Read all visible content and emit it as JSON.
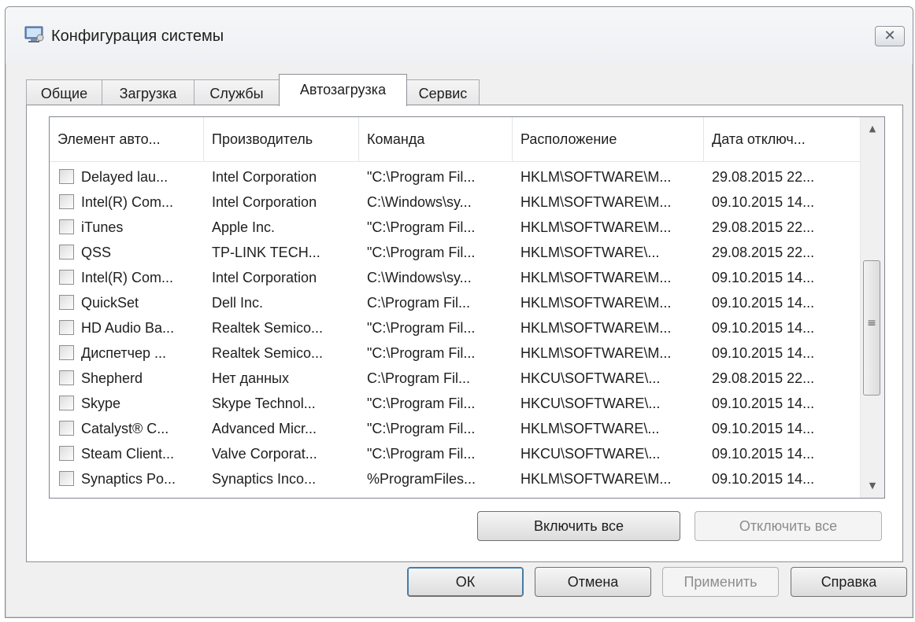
{
  "window": {
    "title": "Конфигурация системы",
    "close_glyph": "✕"
  },
  "tabs": [
    {
      "label": "Общие",
      "active": false
    },
    {
      "label": "Загрузка",
      "active": false
    },
    {
      "label": "Службы",
      "active": false
    },
    {
      "label": "Автозагрузка",
      "active": true
    },
    {
      "label": "Сервис",
      "active": false
    }
  ],
  "list": {
    "columns": [
      "Элемент авто...",
      "Производитель",
      "Команда",
      "Расположение",
      "Дата отключ..."
    ],
    "rows": [
      [
        "Delayed lau...",
        "Intel Corporation",
        "\"C:\\Program Fil...",
        "HKLM\\SOFTWARE\\M...",
        "29.08.2015 22..."
      ],
      [
        "Intel(R) Com...",
        "Intel Corporation",
        "C:\\Windows\\sy...",
        "HKLM\\SOFTWARE\\M...",
        "09.10.2015 14..."
      ],
      [
        "iTunes",
        "Apple Inc.",
        "\"C:\\Program Fil...",
        "HKLM\\SOFTWARE\\M...",
        "29.08.2015 22..."
      ],
      [
        "QSS",
        "TP-LINK TECH...",
        "\"C:\\Program Fil...",
        "HKLM\\SOFTWARE\\...",
        "29.08.2015 22..."
      ],
      [
        "Intel(R) Com...",
        "Intel Corporation",
        "C:\\Windows\\sy...",
        "HKLM\\SOFTWARE\\M...",
        "09.10.2015 14..."
      ],
      [
        "QuickSet",
        "Dell Inc.",
        "C:\\Program Fil...",
        "HKLM\\SOFTWARE\\M...",
        "09.10.2015 14..."
      ],
      [
        "HD Audio Ba...",
        "Realtek Semico...",
        "\"C:\\Program Fil...",
        "HKLM\\SOFTWARE\\M...",
        "09.10.2015 14..."
      ],
      [
        "Диспетчер ...",
        "Realtek Semico...",
        "\"C:\\Program Fil...",
        "HKLM\\SOFTWARE\\M...",
        "09.10.2015 14..."
      ],
      [
        "Shepherd",
        "Нет данных",
        "C:\\Program Fil...",
        "HKCU\\SOFTWARE\\...",
        "29.08.2015 22..."
      ],
      [
        "Skype",
        "Skype Technol...",
        "\"C:\\Program Fil...",
        "HKCU\\SOFTWARE\\...",
        "09.10.2015 14..."
      ],
      [
        "Catalyst® C...",
        "Advanced Micr...",
        "\"C:\\Program Fil...",
        "HKLM\\SOFTWARE\\...",
        "09.10.2015 14..."
      ],
      [
        "Steam Client...",
        "Valve Corporat...",
        "\"C:\\Program Fil...",
        "HKCU\\SOFTWARE\\...",
        "09.10.2015 14..."
      ],
      [
        "Synaptics Po...",
        "Synaptics Inco...",
        "%ProgramFiles...",
        "HKLM\\SOFTWARE\\M...",
        "09.10.2015 14..."
      ]
    ]
  },
  "buttons": {
    "enable_all": "Включить все",
    "disable_all": "Отключить все",
    "ok": "ОК",
    "cancel": "Отмена",
    "apply": "Применить",
    "help": "Справка"
  },
  "icons": {
    "scroll_up": "▲",
    "scroll_down": "▼",
    "grip": "≡"
  }
}
